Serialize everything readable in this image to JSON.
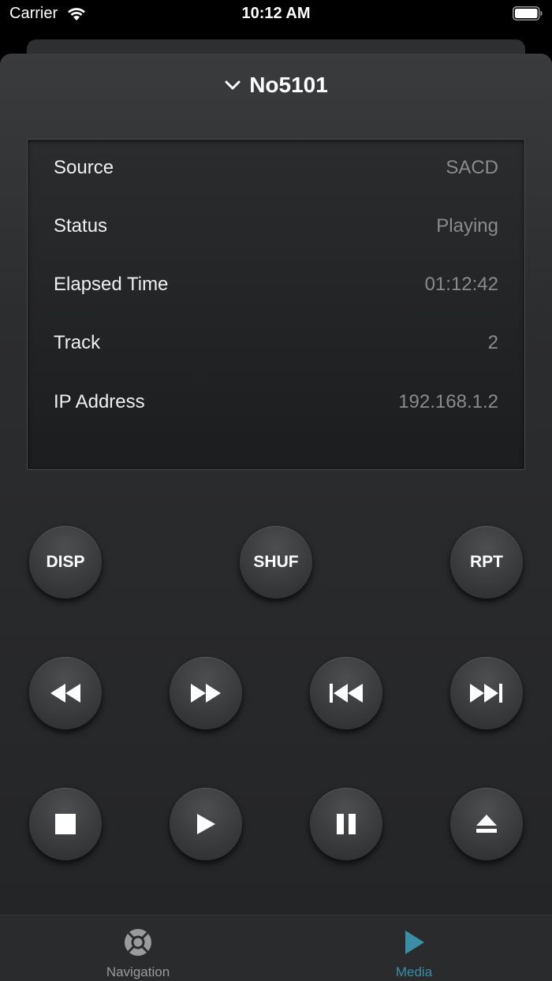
{
  "status_bar": {
    "carrier": "Carrier",
    "time": "10:12 AM"
  },
  "device": {
    "name": "No5101"
  },
  "info": [
    {
      "label": "Source",
      "value": "SACD"
    },
    {
      "label": "Status",
      "value": "Playing"
    },
    {
      "label": "Elapsed Time",
      "value": "01:12:42"
    },
    {
      "label": "Track",
      "value": "2"
    },
    {
      "label": "IP Address",
      "value": "192.168.1.2"
    }
  ],
  "buttons": {
    "disp": "DISP",
    "shuf": "SHUF",
    "rpt": "RPT",
    "transport_icons": [
      "rewind-icon",
      "fast-forward-icon",
      "skip-previous-icon",
      "skip-next-icon",
      "stop-icon",
      "play-icon",
      "pause-icon",
      "eject-icon"
    ]
  },
  "tabs": [
    {
      "label": "Navigation",
      "icon": "navigation-pad-icon",
      "active": false
    },
    {
      "label": "Media",
      "icon": "media-play-icon",
      "active": true
    }
  ],
  "colors": {
    "accent": "#3a8ea6",
    "inactive": "#9a9b9d",
    "value_text": "#8a8b8d"
  }
}
